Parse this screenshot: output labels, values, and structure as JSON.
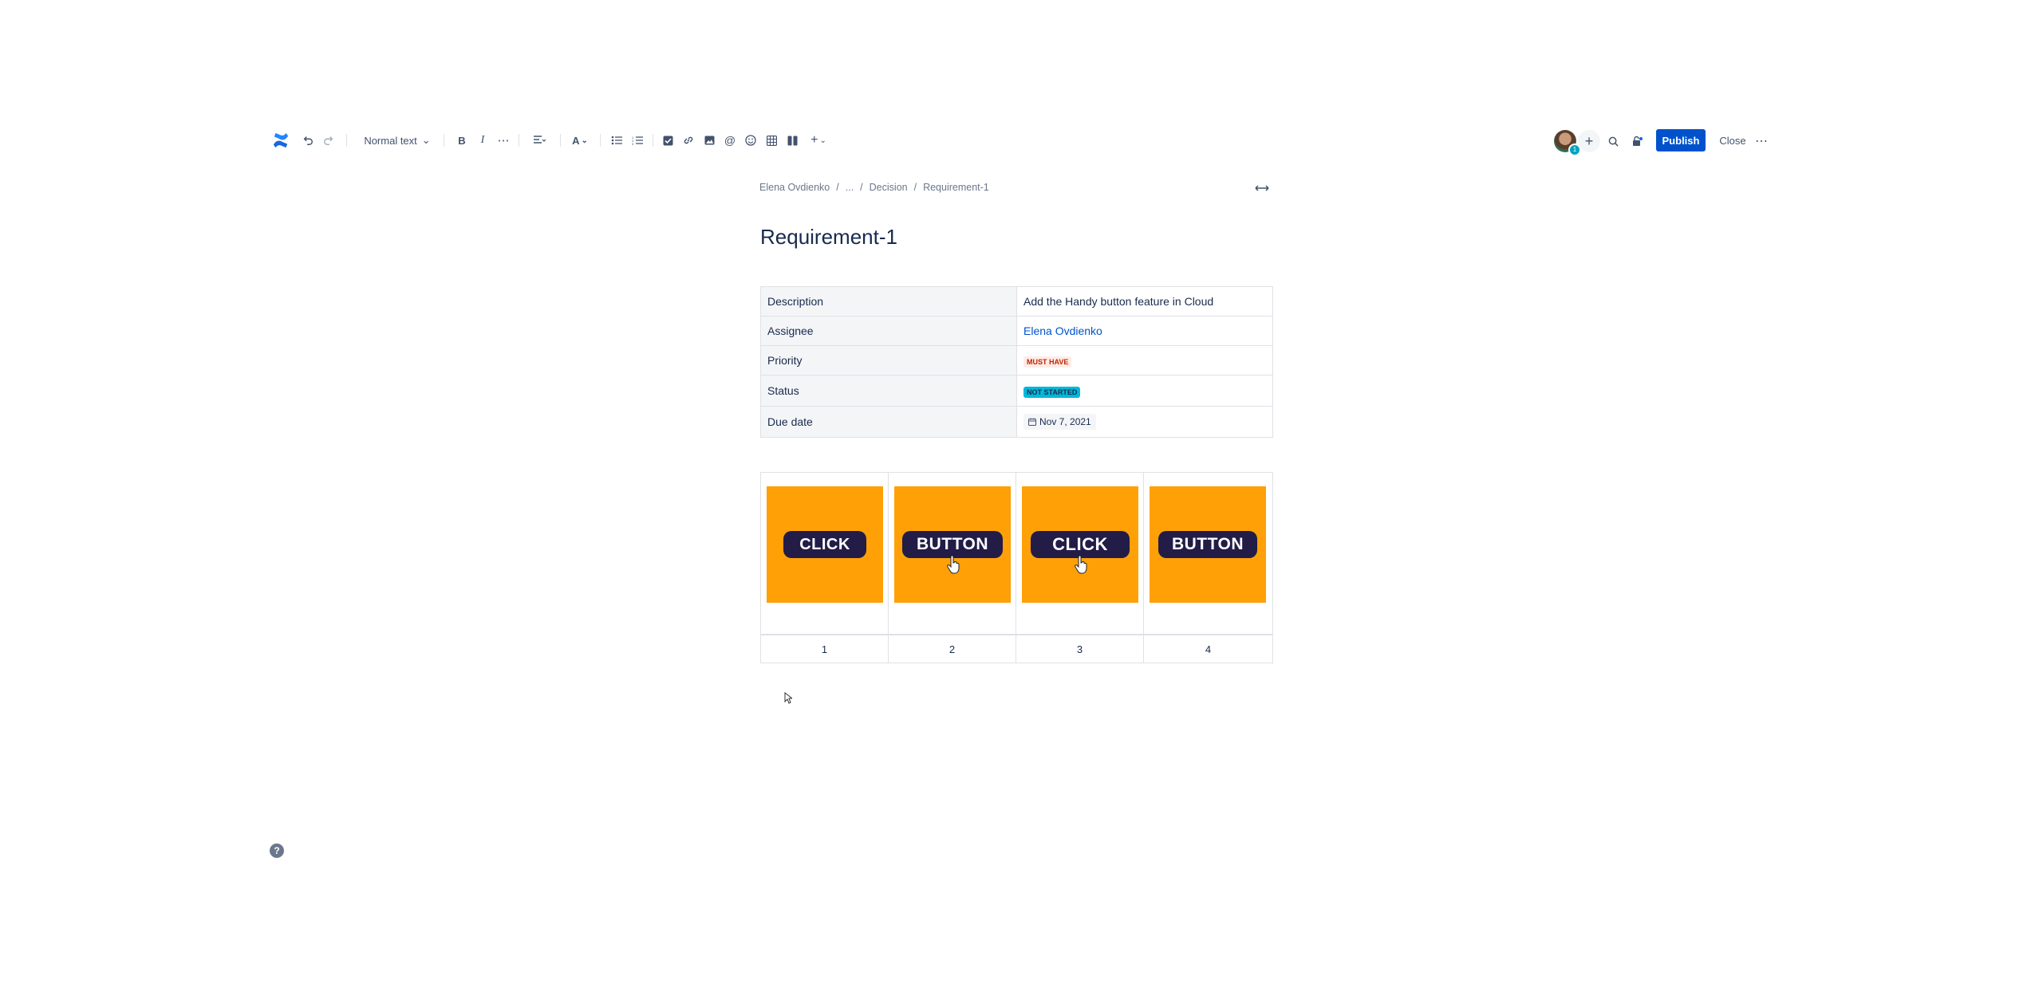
{
  "toolbar": {
    "text_style": "Normal text",
    "items": [
      "logo-icon",
      "undo-icon",
      "redo-icon",
      "bold-icon",
      "italic-icon",
      "more-formatting-icon",
      "align-icon",
      "text-color-icon",
      "bullet-list-icon",
      "numbered-list-icon",
      "action-item-icon",
      "link-icon",
      "image-icon",
      "mention-icon",
      "emoji-icon",
      "table-icon",
      "layouts-icon",
      "insert-icon"
    ],
    "publish_label": "Publish",
    "close_label": "Close",
    "avatar_badge": "1"
  },
  "breadcrumb": {
    "items": [
      "Elena Ovdienko",
      "...",
      "Decision",
      "Requirement-1"
    ],
    "separator": "/"
  },
  "page": {
    "title": "Requirement-1"
  },
  "properties": [
    {
      "key": "Description",
      "value": "Add the Handy button feature in Cloud"
    },
    {
      "key": "Assignee",
      "value": "Elena Ovdienko"
    },
    {
      "key": "Priority",
      "value": "MUST HAVE"
    },
    {
      "key": "Status",
      "value": "NOT STARTED"
    },
    {
      "key": "Due date",
      "value": "Nov 7, 2021"
    }
  ],
  "images": [
    {
      "label": "CLICK",
      "caption": "1",
      "cursor": false
    },
    {
      "label": "BUTTON",
      "caption": "2",
      "cursor": true
    },
    {
      "label": "CLICK",
      "caption": "3",
      "cursor": true
    },
    {
      "label": "BUTTON",
      "caption": "4",
      "cursor": false
    }
  ],
  "colors": {
    "brand": "#0052cc",
    "tile": "#ffa007",
    "pill": "#221c47"
  }
}
